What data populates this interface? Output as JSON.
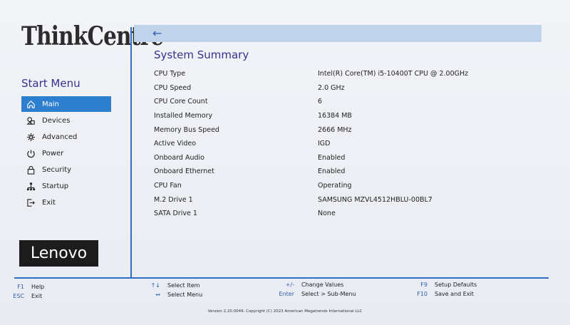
{
  "brand": {
    "product": "ThinkCentre",
    "vendor": "Lenovo"
  },
  "start_menu": {
    "title": "Start Menu",
    "items": [
      {
        "label": "Main",
        "icon": "home-icon",
        "active": true
      },
      {
        "label": "Devices",
        "icon": "devices-icon",
        "active": false
      },
      {
        "label": "Advanced",
        "icon": "advanced-icon",
        "active": false
      },
      {
        "label": "Power",
        "icon": "power-icon",
        "active": false
      },
      {
        "label": "Security",
        "icon": "lock-icon",
        "active": false
      },
      {
        "label": "Startup",
        "icon": "startup-icon",
        "active": false
      },
      {
        "label": "Exit",
        "icon": "exit-icon",
        "active": false
      }
    ]
  },
  "page": {
    "title": "System Summary",
    "rows": [
      {
        "label": "CPU Type",
        "value": "Intel(R) Core(TM) i5-10400T CPU @ 2.00GHz"
      },
      {
        "label": "CPU Speed",
        "value": "2.0 GHz"
      },
      {
        "label": "CPU Core Count",
        "value": "6"
      },
      {
        "label": "Installed Memory",
        "value": "16384 MB"
      },
      {
        "label": "Memory Bus Speed",
        "value": "2666 MHz"
      },
      {
        "label": "Active Video",
        "value": "IGD"
      },
      {
        "label": "Onboard Audio",
        "value": "Enabled"
      },
      {
        "label": "Onboard Ethernet",
        "value": "Enabled"
      },
      {
        "label": "CPU Fan",
        "value": "Operating"
      },
      {
        "label": "M.2 Drive 1",
        "value": "SAMSUNG MZVL4512HBLU-00BL7"
      },
      {
        "label": "SATA Drive 1",
        "value": "None"
      }
    ]
  },
  "footer": {
    "keys": [
      {
        "key": "F1",
        "desc": "Help"
      },
      {
        "key": "ESC",
        "desc": "Exit"
      },
      {
        "key": "↑↓",
        "desc": "Select Item"
      },
      {
        "key": "↔",
        "desc": "Select Menu"
      },
      {
        "key": "+/-",
        "desc": "Change Values"
      },
      {
        "key": "Enter",
        "desc": "Select > Sub-Menu"
      },
      {
        "key": "F9",
        "desc": "Setup Defaults"
      },
      {
        "key": "F10",
        "desc": "Save and Exit"
      }
    ],
    "version": "Version 2.20.0049. Copyright (C) 2023 American Megatrends International LLC"
  },
  "colors": {
    "accent": "#2f7fd1",
    "title": "#3b2f8f",
    "divider": "#2f6fc7",
    "header_bar": "#bfd3ea"
  }
}
